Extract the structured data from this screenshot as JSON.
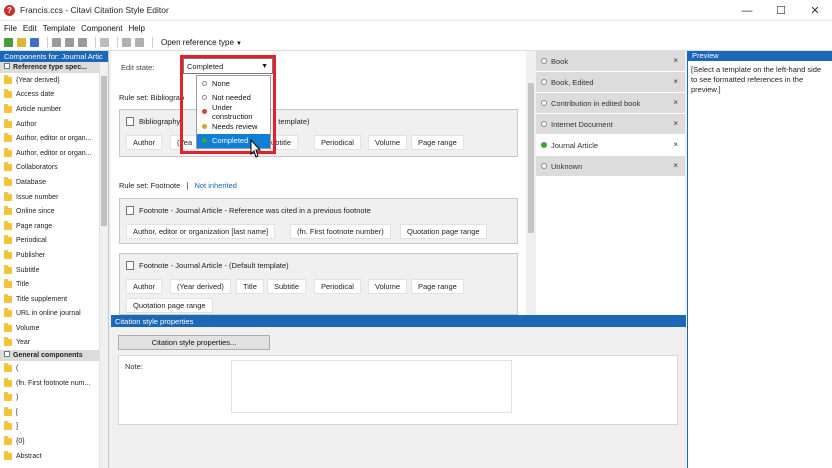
{
  "window": {
    "title": "Francis.ccs - Citavi Citation Style Editor",
    "app_icon": "?",
    "controls": [
      "—",
      "☐",
      "✕"
    ]
  },
  "menu": [
    "File",
    "Edit",
    "Template",
    "Component",
    "Help"
  ],
  "toolbar": {
    "open_reference_type": "Open reference type"
  },
  "left_panel": {
    "title": "Components for: Journal Artic",
    "group1": "Reference type spec...",
    "items": [
      "{Year derived}",
      "Access date",
      "Article number",
      "Author",
      "Author, editor or organ...",
      "Author, editor or organ...",
      "Collaborators",
      "Database",
      "Issue number",
      "Online since",
      "Page range",
      "Periodical",
      "Publisher",
      "Subtitle",
      "Title",
      "Title supplement",
      "URL in online journal",
      "Volume",
      "Year"
    ],
    "group2": "General components",
    "general_items": [
      "(",
      "(fn. First footnote num...",
      ")",
      "[",
      "]",
      "{0}",
      "Abstract"
    ]
  },
  "editor": {
    "edit_state_label": "Edit state:",
    "combo_value": "Completed",
    "dropdown_options": [
      {
        "label": "None",
        "color": "#ffffff"
      },
      {
        "label": "Not needed",
        "color": "#ffffff"
      },
      {
        "label": "Under construction",
        "color": "#d64141"
      },
      {
        "label": "Needs review",
        "color": "#e0a021"
      },
      {
        "label": "Completed",
        "color": "#3fa23f"
      }
    ],
    "rule_set_bib": "Rule set: Bibliograp",
    "bib_template_title": "Bibliography",
    "bib_template_title_end": "template)",
    "bib_chips": [
      "Author",
      "(Yea",
      "ubtitle",
      "Periodical",
      "Volume",
      "Page range"
    ],
    "rule_set_fn": "Rule set: Footnote",
    "rule_set_fn_sep": "|",
    "not_inherited": "Not inherited",
    "fn1_title": "Footnote - Journal Article - Reference was cited in a previous footnote",
    "fn1_chips": [
      "Author, editor or organization [last name]",
      "(fn. First footnote number)",
      "Quotation page range"
    ],
    "fn2_title": "Footnote - Journal Article - (Default template)",
    "fn2_chips": [
      "Author",
      "(Year derived)",
      "Title",
      "Subtitle",
      "Periodical",
      "Volume",
      "Page range"
    ],
    "fn2_chips_row2": [
      "Quotation page range"
    ]
  },
  "reference_types": [
    {
      "label": "Book",
      "active": false,
      "green": false
    },
    {
      "label": "Book, Edited",
      "active": false,
      "green": false
    },
    {
      "label": "Contribution in edited book",
      "active": false,
      "green": false
    },
    {
      "label": "Internet Document",
      "active": false,
      "green": false
    },
    {
      "label": "Journal Article",
      "active": true,
      "green": true
    },
    {
      "label": "Unknown",
      "active": false,
      "green": false
    }
  ],
  "close_glyph": "×",
  "preview": {
    "title": "Preview",
    "text": "[Select a template on the left-hand side to see formatted references in the preview.]"
  },
  "properties": {
    "title": "Citation style properties",
    "button": "Citation style properties...",
    "note_label": "Note:"
  }
}
